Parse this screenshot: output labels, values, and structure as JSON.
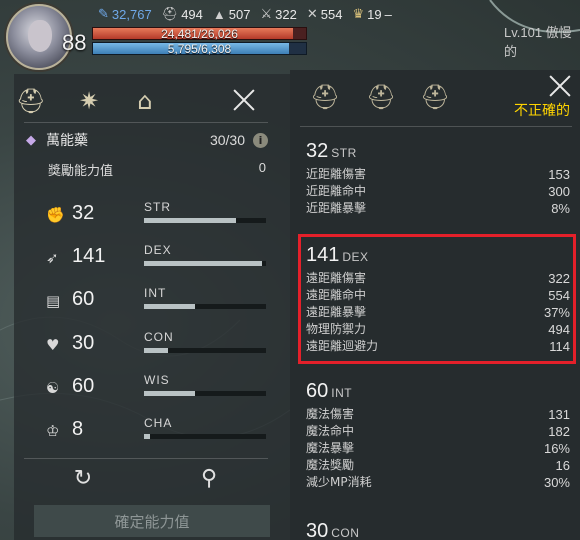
{
  "hud": {
    "level": "88",
    "power": "32,767",
    "stat_a": "494",
    "stat_b": "507",
    "stat_c": "322",
    "stat_d": "554",
    "stat_e": "19",
    "stat_e_suffix": "–",
    "hp_text": "24,481/26,026",
    "hp_fraction": 0.94,
    "mp_text": "5,795/6,308",
    "mp_fraction": 0.92,
    "right_level": "Lv.101 傲慢的"
  },
  "left_panel": {
    "potion_name": "萬能藥",
    "potion_count": "30/30",
    "info_label": "i",
    "bonus_label": "獎勵能力值",
    "bonus_value": "0",
    "stats": [
      {
        "icon": "fist-icon",
        "value": "32",
        "name": "STR",
        "fill": 0.75
      },
      {
        "icon": "bow-icon",
        "value": "141",
        "name": "DEX",
        "fill": 0.97
      },
      {
        "icon": "book-icon",
        "value": "60",
        "name": "INT",
        "fill": 0.42
      },
      {
        "icon": "heart-icon",
        "value": "30",
        "name": "CON",
        "fill": 0.2
      },
      {
        "icon": "mind-icon",
        "value": "60",
        "name": "WIS",
        "fill": 0.42
      },
      {
        "icon": "crown-icon",
        "value": "8",
        "name": "CHA",
        "fill": 0.05
      }
    ],
    "confirm_label": "確定能力值"
  },
  "right_panel": {
    "warning": "不正確的",
    "sections": [
      {
        "value": "32",
        "abbr": "STR",
        "lines": [
          {
            "label": "近距離傷害",
            "value": "153"
          },
          {
            "label": "近距離命中",
            "value": "300"
          },
          {
            "label": "近距離暴擊",
            "value": "8%"
          }
        ]
      },
      {
        "value": "141",
        "abbr": "DEX",
        "lines": [
          {
            "label": "遠距離傷害",
            "value": "322"
          },
          {
            "label": "遠距離命中",
            "value": "554"
          },
          {
            "label": "遠距離暴擊",
            "value": "37%"
          },
          {
            "label": "物理防禦力",
            "value": "494"
          },
          {
            "label": "遠距離迴避力",
            "value": "114"
          }
        ]
      },
      {
        "value": "60",
        "abbr": "INT",
        "lines": [
          {
            "label": "魔法傷害",
            "value": "131"
          },
          {
            "label": "魔法命中",
            "value": "182"
          },
          {
            "label": "魔法暴擊",
            "value": "16%"
          },
          {
            "label": "魔法獎勵",
            "value": "16"
          },
          {
            "label": "減少MP消耗",
            "value": "30%"
          }
        ]
      },
      {
        "value": "30",
        "abbr": "CON",
        "lines": []
      }
    ]
  },
  "colors": {
    "highlight": "#e4202a",
    "warning": "#ffd400",
    "power_blue": "#6fa8e8"
  }
}
